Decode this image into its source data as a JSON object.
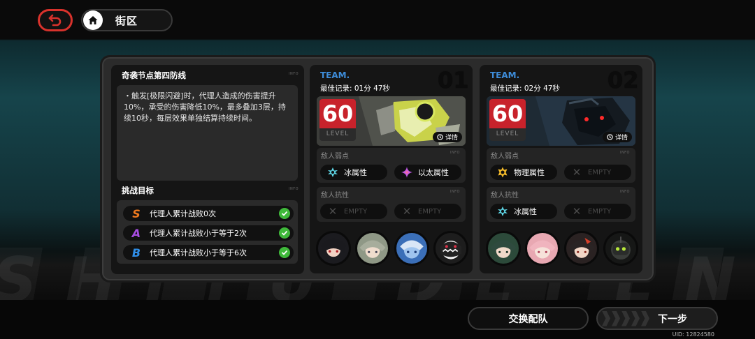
{
  "header": {
    "title": "街区"
  },
  "challenge": {
    "title": "奇袭节点第四防线",
    "info_tag": "INFO",
    "description": "・触发[极限闪避]时，代理人造成的伤害提升10%，承受的伤害降低10%，最多叠加3层，持续10秒，每层效果单独结算持续时间。",
    "goals_title": "挑战目标",
    "goals": [
      {
        "grade": "S",
        "text": "代理人累计战败0次",
        "color": "#f07a1e"
      },
      {
        "grade": "A",
        "text": "代理人累计战败小于等于2次",
        "color": "#a64ce0"
      },
      {
        "grade": "B",
        "text": "代理人累计战败小于等于6次",
        "color": "#2f8ee8"
      }
    ]
  },
  "teams": [
    {
      "label": "TEAM.",
      "number": "01",
      "best": "最佳记录: 01分 47秒",
      "level": "60",
      "level_label": "LEVEL",
      "detail": "详情",
      "weak_title": "敌人弱点",
      "weak": [
        {
          "icon": "ice-icon",
          "text": "冰属性",
          "empty": false
        },
        {
          "icon": "ether-icon",
          "text": "以太属性",
          "empty": false
        }
      ],
      "resist_title": "敌人抗性",
      "resist": [
        {
          "icon": "x-icon",
          "text": "EMPTY",
          "empty": true
        },
        {
          "icon": "x-icon",
          "text": "EMPTY",
          "empty": true
        }
      ]
    },
    {
      "label": "TEAM.",
      "number": "02",
      "best": "最佳记录: 02分 47秒",
      "level": "60",
      "level_label": "LEVEL",
      "detail": "详情",
      "weak_title": "敌人弱点",
      "weak": [
        {
          "icon": "physical-icon",
          "text": "物理属性",
          "empty": false
        },
        {
          "icon": "x-icon",
          "text": "EMPTY",
          "empty": true
        }
      ],
      "resist_title": "敌人抗性",
      "resist": [
        {
          "icon": "ice-icon",
          "text": "冰属性",
          "empty": false
        },
        {
          "icon": "x-icon",
          "text": "EMPTY",
          "empty": true
        }
      ]
    }
  ],
  "buttons": {
    "swap": "交换配队",
    "next": "下一步"
  },
  "uid": "UID: 12824580",
  "colors": {
    "accent_red": "#c8222b",
    "team_blue": "#3d8cd9",
    "check_green": "#3fb93a"
  }
}
